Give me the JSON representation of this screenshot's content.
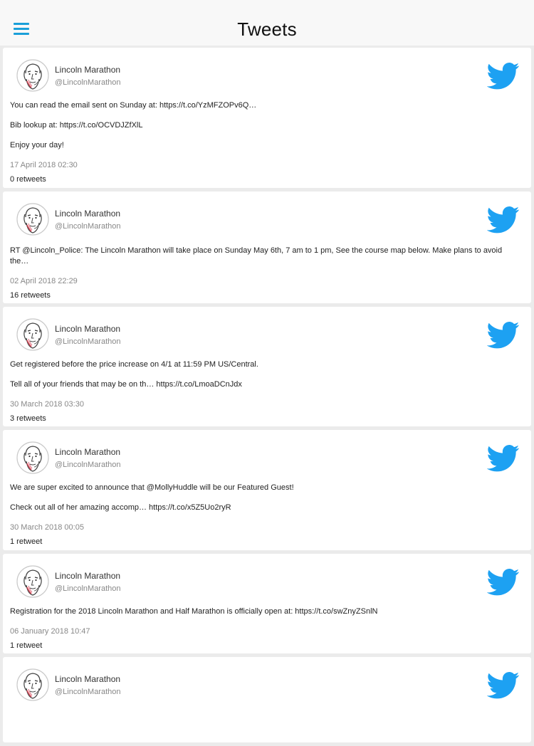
{
  "header": {
    "title": "Tweets",
    "menu_icon": "hamburger-menu-icon",
    "accent_color": "#1a9fd9"
  },
  "colors": {
    "twitter_blue": "#1da1f2",
    "background": "#ebebeb",
    "card": "#ffffff"
  },
  "tweets": [
    {
      "name": "Lincoln Marathon",
      "handle": "@LincolnMarathon",
      "lines": [
        "You can read the email sent on Sunday at: https://t.co/YzMFZOPv6Q…",
        "Bib lookup at: https://t.co/OCVDJZfXlL",
        "Enjoy your day!"
      ],
      "date": "17 April 2018 02:30",
      "retweets": "0 retweets"
    },
    {
      "name": "Lincoln Marathon",
      "handle": "@LincolnMarathon",
      "lines": [
        "RT @Lincoln_Police: The Lincoln Marathon will take place on Sunday May 6th, 7 am to 1 pm, See the course map below. Make plans to avoid the…"
      ],
      "date": "02 April 2018 22:29",
      "retweets": "16 retweets"
    },
    {
      "name": "Lincoln Marathon",
      "handle": "@LincolnMarathon",
      "lines": [
        "Get registered before the price increase on 4/1 at 11:59 PM US/Central.",
        "Tell all of your friends that may be on th… https://t.co/LmoaDCnJdx"
      ],
      "date": "30 March 2018 03:30",
      "retweets": "3 retweets"
    },
    {
      "name": "Lincoln Marathon",
      "handle": "@LincolnMarathon",
      "lines": [
        "We are super excited to announce that @MollyHuddle will be our Featured Guest!",
        "Check out all of her amazing accomp… https://t.co/x5Z5Uo2ryR"
      ],
      "date": "30 March 2018 00:05",
      "retweets": "1 retweet"
    },
    {
      "name": "Lincoln Marathon",
      "handle": "@LincolnMarathon",
      "lines": [
        "Registration for the 2018 Lincoln Marathon and Half Marathon is officially open at: https://t.co/swZnyZSnlN"
      ],
      "date": "06 January 2018 10:47",
      "retweets": "1 retweet"
    },
    {
      "name": "Lincoln Marathon",
      "handle": "@LincolnMarathon",
      "lines": [],
      "date": "",
      "retweets": ""
    }
  ]
}
